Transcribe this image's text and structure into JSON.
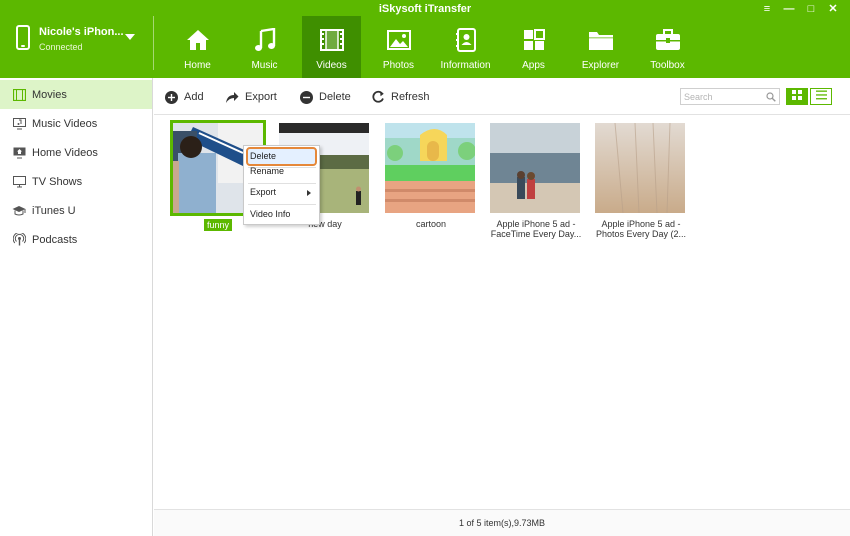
{
  "app": {
    "title": "iSkysoft iTransfer"
  },
  "window_controls": {
    "menu": "≡",
    "minimize": "—",
    "maximize": "□",
    "close": "✕"
  },
  "device": {
    "name": "Nicole's iPhon...",
    "status": "Connected"
  },
  "nav": {
    "tabs": [
      {
        "label": "Home",
        "icon": "home-icon"
      },
      {
        "label": "Music",
        "icon": "music-note-icon"
      },
      {
        "label": "Videos",
        "icon": "film-icon",
        "active": true
      },
      {
        "label": "Photos",
        "icon": "photo-icon"
      },
      {
        "label": "Information",
        "icon": "contacts-book-icon"
      },
      {
        "label": "Apps",
        "icon": "apps-grid-icon"
      },
      {
        "label": "Explorer",
        "icon": "folder-icon"
      },
      {
        "label": "Toolbox",
        "icon": "toolbox-icon"
      }
    ]
  },
  "sidebar": {
    "items": [
      {
        "label": "Movies",
        "icon": "film-icon",
        "active": true
      },
      {
        "label": "Music Videos",
        "icon": "monitor-music-icon"
      },
      {
        "label": "Home Videos",
        "icon": "monitor-home-icon"
      },
      {
        "label": "TV Shows",
        "icon": "tv-icon"
      },
      {
        "label": "iTunes U",
        "icon": "graduation-cap-icon"
      },
      {
        "label": "Podcasts",
        "icon": "podcast-icon"
      }
    ]
  },
  "toolbar": {
    "add_label": "Add",
    "export_label": "Export",
    "delete_label": "Delete",
    "refresh_label": "Refresh",
    "search_placeholder": "Search"
  },
  "videos": [
    {
      "title": "funny",
      "selected": true
    },
    {
      "title": "new day"
    },
    {
      "title": "cartoon"
    },
    {
      "title": "Apple iPhone 5 ad - FaceTime Every Day..."
    },
    {
      "title": "Apple iPhone 5 ad - Photos Every Day (2..."
    }
  ],
  "context_menu": {
    "items": [
      {
        "label": "Delete",
        "highlighted": true
      },
      {
        "label": "Rename"
      },
      {
        "label": "Export",
        "has_submenu": true
      },
      {
        "label": "Video Info"
      }
    ]
  },
  "status": {
    "text": "1 of 5 item(s),9.73MB"
  },
  "colors": {
    "accent": "#5cb800",
    "accent_dark": "#3f8f00",
    "sidebar_active": "#ddf4c8",
    "menu_highlight_border": "#e5883a"
  }
}
